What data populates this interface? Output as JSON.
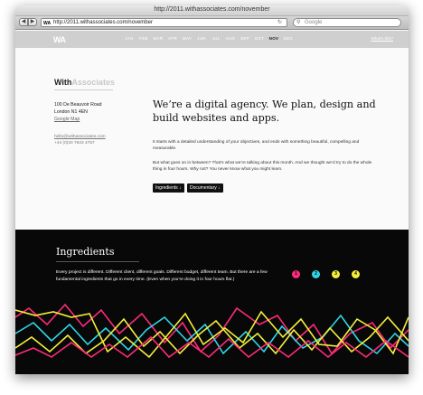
{
  "browser": {
    "title": "http://2011.withassociates.com/november",
    "url": "http://2011.withassociates.com/november",
    "favicon": "WA",
    "search_placeholder": "Google",
    "back_icon": "◀",
    "forward_icon": "▶",
    "reload_icon": "↻",
    "search_icon": "⚲"
  },
  "site": {
    "logo": "WA",
    "months": [
      "JAN",
      "FEB",
      "MAR",
      "APR",
      "MAY",
      "JUN",
      "JUL",
      "AUG",
      "SEP",
      "OCT",
      "NOV",
      "DEC"
    ],
    "active_month": "NOV",
    "whats_this": "What's this?"
  },
  "brand": {
    "with": "With",
    "associates": "Associates"
  },
  "address": {
    "line1": "100 De Beauvoir Road",
    "line2": "London N1 4EN",
    "map_link": "Google Map",
    "email": "hello@withassociates.com",
    "phone": "+44 (0)20 7923 4757"
  },
  "intro": {
    "headline": "We’re a digital agency. We plan, design and build websites and apps.",
    "p1": "It starts with a detailed understanding of your objectives, and ends with something beautiful, compelling and measurable.",
    "p2": "But what goes on in between? That’s what we’re talking about this month. And we thought we’d try to do the whole thing in four hours. Why not? You never know what you might learn.",
    "btn_ingredients": "Ingredients ↓",
    "btn_documentary": "Documentary ↓"
  },
  "ingredients": {
    "title": "Ingredients",
    "text": "Every project is different. Different client, different goals. Different budget, different team. But there are a few fundamental ingredients that go in every time. (Even when you’re doing it in four hours flat.)",
    "dots": [
      {
        "label": "1",
        "color": "#ff2a7a"
      },
      {
        "label": "2",
        "color": "#2fd6e6"
      },
      {
        "label": "3",
        "color": "#f4f03a"
      },
      {
        "label": "4",
        "color": "#f4f03a"
      }
    ]
  },
  "colors": {
    "pink": "#ff2a7a",
    "cyan": "#2fd6e6",
    "yellow": "#f4f03a",
    "nav_bg": "#cfcfcf",
    "dark_bg": "#080808"
  }
}
